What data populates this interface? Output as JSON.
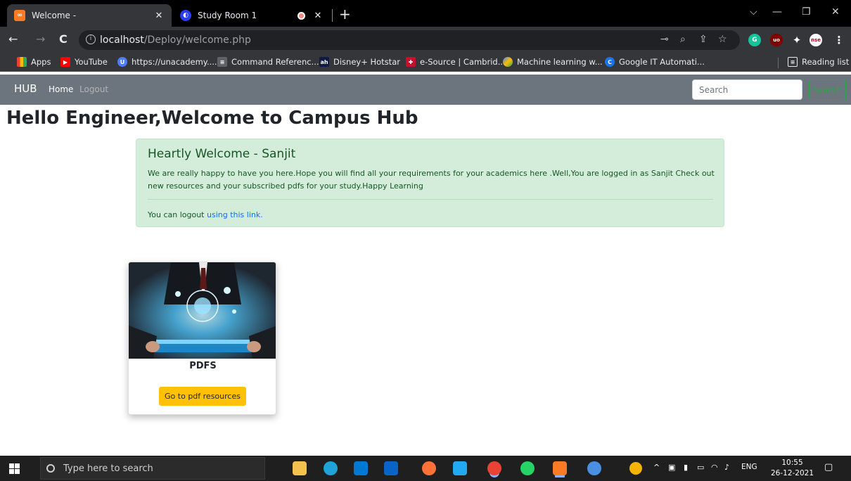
{
  "browser": {
    "tabs": [
      {
        "title": "Welcome -",
        "favicon": "xampp-icon",
        "active": true
      },
      {
        "title": "Study Room 1",
        "favicon": "study-room-icon",
        "active": false,
        "recording": true
      }
    ],
    "new_tab_symbol": "+",
    "window_controls": {
      "tab_search": "⌵",
      "minimize": "—",
      "maximize": "❐",
      "close": "✕"
    },
    "nav": {
      "back": "←",
      "forward": "→",
      "reload": "C"
    },
    "url": {
      "host": "localhost",
      "path": "/Deploy/welcome.php"
    },
    "extensions": {
      "grammarly": "G",
      "ublock": "uo",
      "ext_avatar": "nse"
    },
    "bookmarks": [
      {
        "label": "Apps"
      },
      {
        "label": "YouTube"
      },
      {
        "label": "https://unacademy...."
      },
      {
        "label": "Command Referenc..."
      },
      {
        "label": "Disney+ Hotstar",
        "icon_text": "ah"
      },
      {
        "label": "e-Source | Cambrid..."
      },
      {
        "label": "Machine learning w..."
      },
      {
        "label": "Google IT Automati...",
        "icon_text": "C"
      }
    ],
    "reading_list": "Reading list"
  },
  "navbar": {
    "brand": "HUB",
    "links": [
      "Home",
      "Logout"
    ],
    "search_placeholder": "Search",
    "search_button": "Search"
  },
  "page": {
    "title": "Hello Engineer,Welcome to Campus Hub",
    "alert": {
      "heading": "Heartly Welcome - Sanjit",
      "body": "We are really happy to have you here.Hope you will find all your requirements for your academics here .Well,You are logged in as Sanjit Check out new resources and your subscribed pdfs for your study.Happy Learning",
      "footer_prefix": "You can logout ",
      "footer_link": "using this link."
    },
    "card": {
      "title": "PDFS",
      "button": "Go to pdf resources",
      "image": "businessman-holding-tablet-technology-image"
    }
  },
  "taskbar": {
    "search_placeholder": "Type here to search",
    "language": "ENG",
    "time": "10:55",
    "date": "26-12-2021"
  },
  "colors": {
    "navbar_bg": "#6c757d",
    "alert_bg": "#d4edda",
    "alert_text": "#155724",
    "link": "#0d6efd",
    "warning_btn": "#ffc107",
    "success_outline": "#28a745"
  }
}
